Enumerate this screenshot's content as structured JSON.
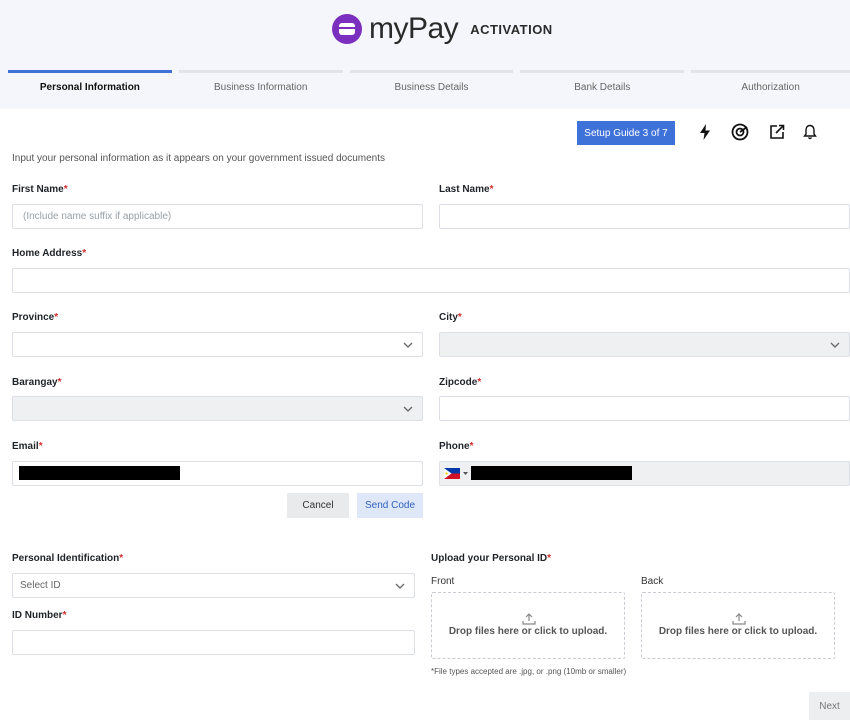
{
  "header": {
    "brand_name": "myPay",
    "brand_subtitle": "ACTIVATION",
    "steps": [
      {
        "label": "Personal Information",
        "active": true
      },
      {
        "label": "Business Information",
        "active": false
      },
      {
        "label": "Business Details",
        "active": false
      },
      {
        "label": "Bank Details",
        "active": false
      },
      {
        "label": "Authorization",
        "active": false
      }
    ]
  },
  "toolbar": {
    "setup_guide_label": "Setup Guide 3 of 7",
    "icons": [
      "lightning-icon",
      "target-icon",
      "external-link-icon",
      "bell-icon"
    ]
  },
  "form": {
    "intro": "Input your personal information as it appears on your government issued documents",
    "required_mark": "*",
    "first_name": {
      "label": "First Name",
      "placeholder": "(Include name suffix if applicable)",
      "value": ""
    },
    "last_name": {
      "label": "Last Name",
      "value": ""
    },
    "home_address": {
      "label": "Home Address",
      "value": ""
    },
    "province": {
      "label": "Province",
      "value": ""
    },
    "city": {
      "label": "City",
      "value": ""
    },
    "barangay": {
      "label": "Barangay",
      "value": ""
    },
    "zipcode": {
      "label": "Zipcode",
      "value": ""
    },
    "email": {
      "label": "Email",
      "value": "[redacted]"
    },
    "phone": {
      "label": "Phone",
      "country": "PH",
      "value": "[redacted]"
    },
    "cancel_label": "Cancel",
    "send_code_label": "Send Code",
    "personal_identification": {
      "label": "Personal Identification",
      "placeholder": "Select ID"
    },
    "id_number": {
      "label": "ID Number",
      "value": ""
    },
    "upload": {
      "label": "Upload your Personal ID",
      "front_label": "Front",
      "back_label": "Back",
      "drop_text": "Drop files here or click to upload.",
      "note": "*File types accepted are .jpg, or .png (10mb or smaller)"
    },
    "next_label": "Next"
  },
  "colors": {
    "accent": "#3f72d9",
    "brand": "#7b2fbe",
    "required": "#d32f2f",
    "header_bg": "#f4f6fc"
  }
}
